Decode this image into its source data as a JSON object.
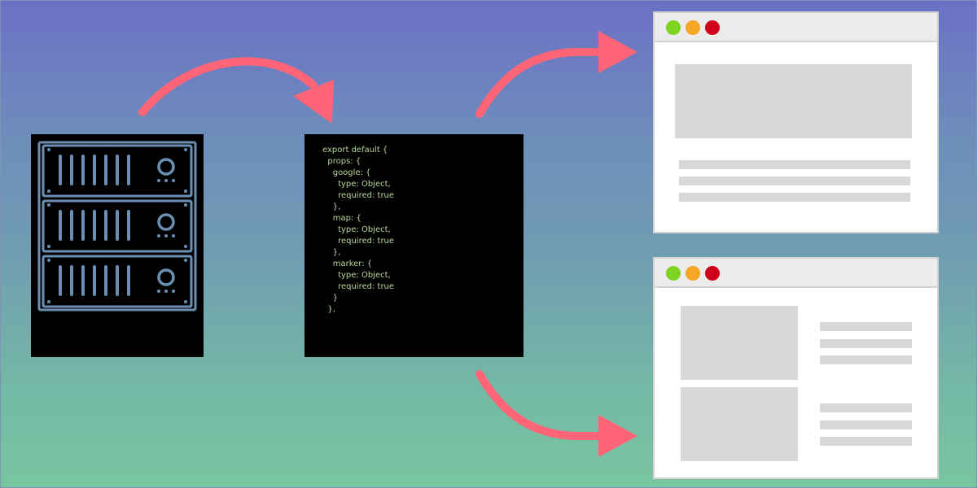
{
  "code_panel": {
    "code": "export default {\n  props: {\n    google: {\n      type: Object,\n      required: true\n    },\n    map: {\n      type: Object,\n      required: true\n    },\n    marker: {\n      type: Object,\n      required: true\n    }\n  },"
  },
  "colors": {
    "arrow": "#ff6577",
    "server_outline": "#6b8fb3",
    "code_text": "#b9d69a",
    "window_green": "#7ed321",
    "window_yellow": "#f5a623",
    "window_red": "#d0021b",
    "placeholder": "#d8d8d8"
  },
  "icons": {
    "server": "server-rack-icon",
    "arrow": "curved-arrow-icon"
  }
}
